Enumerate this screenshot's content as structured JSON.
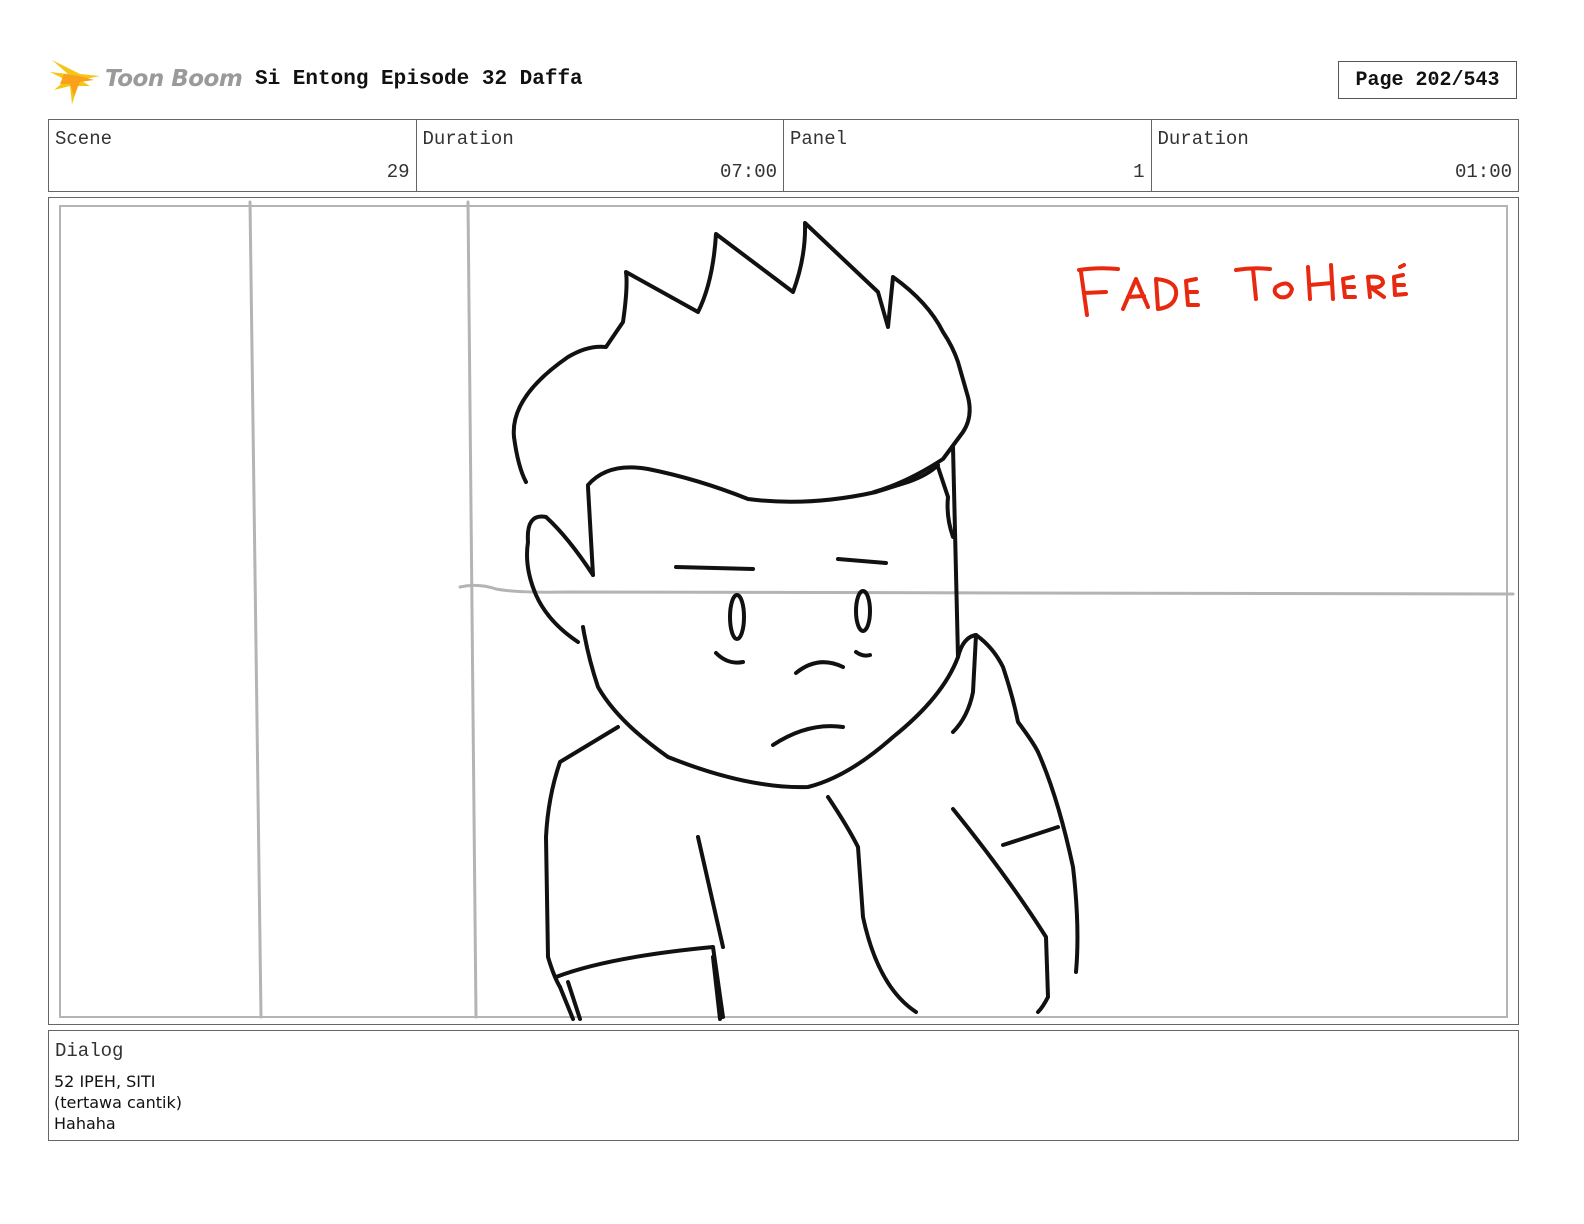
{
  "header": {
    "logo_text": "Toon Boom",
    "project_title": "Si Entong Episode 32 Daffa",
    "page_label": "Page 202/543"
  },
  "info": {
    "scene_label": "Scene",
    "scene_value": "29",
    "scene_duration_label": "Duration",
    "scene_duration_value": "07:00",
    "panel_label": "Panel",
    "panel_value": "1",
    "panel_duration_label": "Duration",
    "panel_duration_value": "01:00"
  },
  "panel": {
    "annotation": "FADE TO HERE",
    "annotation_color": "#e8290f",
    "sketch_color": "#111111",
    "guide_color": "#b4b4b4"
  },
  "dialog": {
    "label": "Dialog",
    "lines": [
      "52 IPEH, SITI",
      "(tertawa cantik)",
      "Hahaha"
    ]
  },
  "colors": {
    "logo_burst": "#f5c518",
    "logo_text": "#9a9a9a",
    "border": "#666666"
  }
}
